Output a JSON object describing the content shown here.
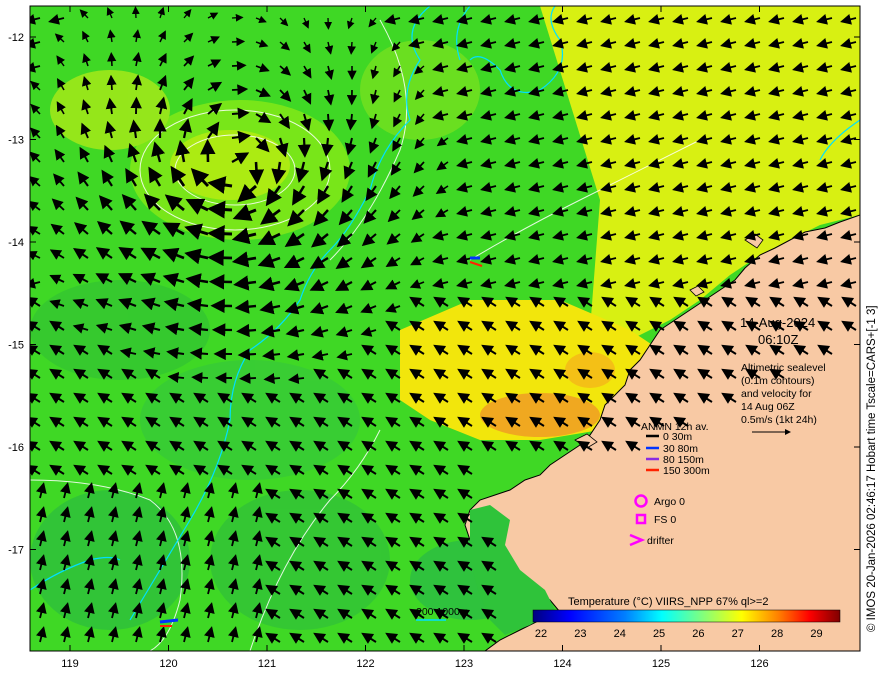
{
  "map": {
    "date": "14-Aug-2024",
    "time": "06:10Z",
    "description_lines": [
      "Altimetric sealevel",
      "(0.1m contours)",
      "and velocity for",
      "14 Aug 06Z",
      "0.5m/s (1kt 24h)"
    ],
    "credit": "© IMOS 20-Jan-2026 02:46:17 Hobart time Tscale=CARS+[-1 3]",
    "x_ticks": [
      "119",
      "120",
      "121",
      "122",
      "123",
      "124",
      "125",
      "126"
    ],
    "y_ticks": [
      "-12",
      "-13",
      "-14",
      "-15",
      "-16",
      "-17"
    ],
    "legend": {
      "title": "ANMN 12h av.",
      "depths": [
        {
          "label": "0 30m",
          "color": "#000000"
        },
        {
          "label": "30 80m",
          "color": "#0033ff"
        },
        {
          "label": "80 150m",
          "color": "#8a2be2"
        },
        {
          "label": "150 300m",
          "color": "#ff2200"
        }
      ],
      "argo": "Argo 0",
      "fs": "FS 0",
      "drifter": "drifter"
    },
    "isobath_label": "200  1000m",
    "colorbar": {
      "title": "Temperature (°C) VIIRS_NPP 67% ql>=2",
      "ticks": [
        "22",
        "23",
        "24",
        "25",
        "26",
        "27",
        "28",
        "29"
      ],
      "min": 22,
      "max": 29.8,
      "colors": [
        "#00007f",
        "#0000ff",
        "#007fff",
        "#00ffff",
        "#7fff7f",
        "#ffff00",
        "#ff7f00",
        "#ff0000",
        "#7f0000"
      ]
    },
    "colors": {
      "land": "#f8c9a4",
      "ocean": "#44dd22",
      "warm_water": "#ffee00",
      "isobath": "#00e0ff",
      "argo_marker": "#ff00ff"
    }
  }
}
